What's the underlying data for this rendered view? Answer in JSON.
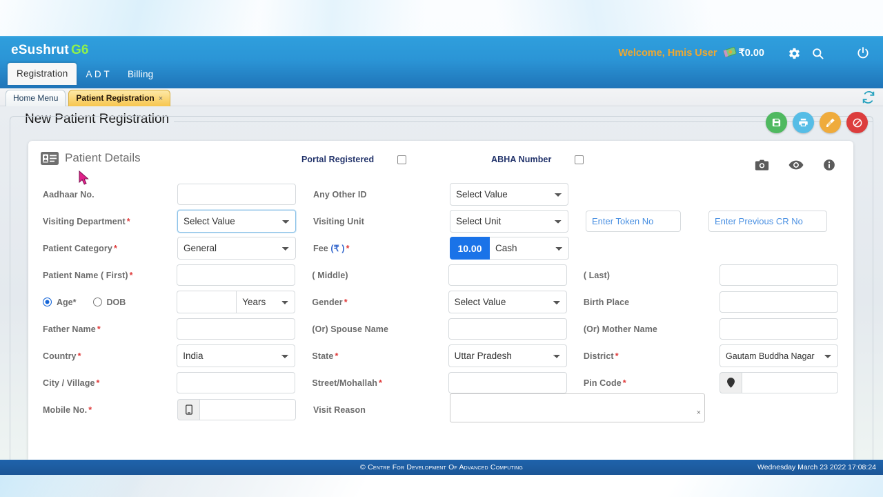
{
  "header": {
    "brand": "eSushrut",
    "brand_suffix": "G6",
    "nav": [
      {
        "label": "Registration",
        "active": true
      },
      {
        "label": "A D T",
        "active": false
      },
      {
        "label": "Billing",
        "active": false
      }
    ],
    "welcome": "Welcome, Hmis User",
    "money_icon": "money-icon",
    "amount": "₹0.00",
    "icons": [
      "gear-icon",
      "search-icon",
      "power-icon"
    ],
    "accent_blue": "#2b95d6",
    "accent_orange": "#f0a830",
    "accent_green": "#8ff04d"
  },
  "tabstrip": {
    "tabs": [
      {
        "label": "Home Menu",
        "active": false,
        "closable": false
      },
      {
        "label": "Patient Registration",
        "active": true,
        "closable": true,
        "close": "×"
      }
    ],
    "refresh_icon": "refresh-icon"
  },
  "page": {
    "title": "New Patient Registration",
    "actions": [
      {
        "name": "save-button",
        "icon": "floppy-disk-icon",
        "color": "#4fb960"
      },
      {
        "name": "print-button",
        "icon": "printer-icon",
        "color": "#56bde6"
      },
      {
        "name": "clear-button",
        "icon": "broom-icon",
        "color": "#efab3c"
      },
      {
        "name": "cancel-button",
        "icon": "ban-icon",
        "color": "#dc3d3d"
      }
    ]
  },
  "card": {
    "title": "Patient Details",
    "title_icon": "id-card-icon",
    "checkboxes": [
      {
        "label": "Portal Registered",
        "checked": false
      },
      {
        "label": "ABHA Number",
        "checked": false
      }
    ],
    "head_icons": [
      "camera-icon",
      "eye-icon",
      "info-icon"
    ]
  },
  "form": {
    "aadhaar_label": "Aadhaar No.",
    "aadhaar_value": "",
    "any_other_id_label": "Any Other ID",
    "any_other_id_value": "Select Value",
    "visiting_department_label": "Visiting Department",
    "visiting_department_value": "Select Value",
    "visiting_unit_label": "Visiting Unit",
    "visiting_unit_value": "Select Unit",
    "token_placeholder": "Enter Token No",
    "token_value": "",
    "prev_cr_placeholder": "Enter Previous CR No",
    "prev_cr_value": "",
    "patient_category_label": "Patient Category",
    "patient_category_value": "General",
    "fee_label": "Fee (₹)",
    "fee_rupee": "₹",
    "fee_value": "10.00",
    "fee_mode": "Cash",
    "first_name_label": "Patient  Name ( First)",
    "first_name_value": "",
    "middle_name_label": "( Middle)",
    "middle_name_value": "",
    "last_name_label": "( Last)",
    "last_name_value": "",
    "age_label": "Age",
    "dob_label": "DOB",
    "age_mode_selected": "Age",
    "age_value": "",
    "age_unit": "Years",
    "gender_label": "Gender",
    "gender_value": "Select Value",
    "birth_place_label": "Birth Place",
    "birth_place_value": "",
    "father_name_label": "Father Name",
    "father_name_value": "",
    "spouse_name_label": "(Or)   Spouse Name",
    "spouse_name_value": "",
    "mother_name_label": "(Or)   Mother Name",
    "mother_name_value": "",
    "country_label": "Country",
    "country_value": "India",
    "state_label": "State",
    "state_value": "Uttar Pradesh",
    "district_label": "District",
    "district_value": "Gautam Buddha Nagar",
    "city_label": "City  /  Village",
    "city_value": "",
    "street_label": "Street/Mohallah",
    "street_value": "",
    "pin_label": "Pin Code",
    "pin_value": "",
    "pin_icon": "map-pin-icon",
    "mobile_label": "Mobile No.",
    "mobile_value": "",
    "mobile_icon": "mobile-phone-icon",
    "visit_reason_label": "Visit Reason",
    "visit_reason_value": "",
    "visit_reason_clear": "×",
    "required_marker": "*"
  },
  "footer": {
    "copyright": "© Centre For Development Of Advanced Computing",
    "datetime": "Wednesday March 23 2022 17:08:24"
  }
}
